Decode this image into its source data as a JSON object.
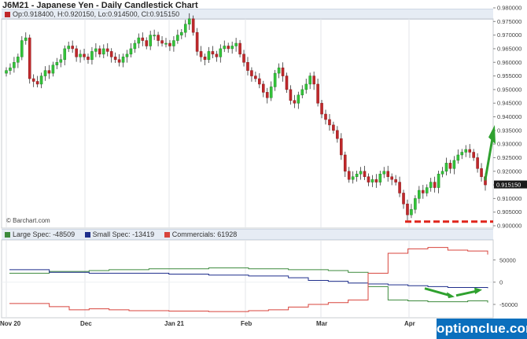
{
  "title": "J6M21 - Japanese Yen - Daily Candlestick Chart",
  "ohlc_label": "Op:0.918400, H:0.920150, Lo:0.914500, Cl:0.915150",
  "credit": "© Barchart.com",
  "watermark": "optionclue.com",
  "colors": {
    "up": "#33c43a",
    "down": "#c0282b",
    "large_spec": "#3c8a3c",
    "small_spec": "#1f2f8c",
    "commercials": "#d8443c",
    "annotation": "#e0251b",
    "arrow": "#2fa12f"
  },
  "chart_data": [
    {
      "type": "candlestick",
      "title": "J6M21 - Japanese Yen - Daily Candlestick Chart",
      "ylim": [
        0.9,
        0.98
      ],
      "y_ticks": [
        "0.980000",
        "0.975000",
        "0.970000",
        "0.965000",
        "0.960000",
        "0.955000",
        "0.950000",
        "0.945000",
        "0.940000",
        "0.935000",
        "0.930000",
        "0.925000",
        "0.920000",
        "0.915000",
        "0.910000",
        "0.905000",
        "0.900000"
      ],
      "last_price_label": "0.915150",
      "x_labels": [
        "Nov 20",
        "Dec",
        "Jan 21",
        "Feb",
        "Mar",
        "Apr"
      ],
      "closes": [
        0.957,
        0.958,
        0.96,
        0.962,
        0.968,
        0.969,
        0.954,
        0.953,
        0.952,
        0.955,
        0.957,
        0.956,
        0.959,
        0.96,
        0.961,
        0.965,
        0.966,
        0.965,
        0.962,
        0.963,
        0.962,
        0.961,
        0.964,
        0.965,
        0.963,
        0.965,
        0.964,
        0.962,
        0.961,
        0.96,
        0.962,
        0.963,
        0.965,
        0.967,
        0.969,
        0.968,
        0.966,
        0.97,
        0.97,
        0.968,
        0.967,
        0.967,
        0.966,
        0.968,
        0.97,
        0.971,
        0.974,
        0.976,
        0.971,
        0.964,
        0.962,
        0.961,
        0.964,
        0.963,
        0.962,
        0.965,
        0.966,
        0.965,
        0.966,
        0.967,
        0.963,
        0.96,
        0.957,
        0.955,
        0.954,
        0.952,
        0.949,
        0.947,
        0.951,
        0.956,
        0.958,
        0.955,
        0.95,
        0.946,
        0.945,
        0.948,
        0.95,
        0.952,
        0.955,
        0.952,
        0.945,
        0.941,
        0.939,
        0.937,
        0.935,
        0.932,
        0.926,
        0.92,
        0.917,
        0.918,
        0.919,
        0.92,
        0.918,
        0.916,
        0.917,
        0.916,
        0.919,
        0.92,
        0.918,
        0.917,
        0.916,
        0.912,
        0.908,
        0.904,
        0.906,
        0.91,
        0.913,
        0.912,
        0.914,
        0.916,
        0.914,
        0.919,
        0.92,
        0.923,
        0.921,
        0.924,
        0.926,
        0.927,
        0.928,
        0.927,
        0.925,
        0.921,
        0.918,
        0.915
      ],
      "cot_series": [
        {
          "name": "Large Spec",
          "legend_value": "-48509",
          "values": [
            20000,
            20000,
            24000,
            24000,
            26000,
            28000,
            28000,
            30000,
            30000,
            30000,
            32000,
            32000,
            30000,
            30000,
            28000,
            28000,
            26000,
            22000,
            -10000,
            -40000,
            -42000,
            -44000,
            -44000,
            -42000,
            -46000
          ]
        },
        {
          "name": "Small Spec",
          "legend_value": "-13419",
          "values": [
            28000,
            28000,
            22000,
            22000,
            20000,
            20000,
            20000,
            20000,
            18000,
            18000,
            16000,
            16000,
            14000,
            14000,
            10000,
            4000,
            2000,
            -2000,
            -4000,
            -6000,
            -8000,
            -10000,
            -12000,
            -12000,
            -13419
          ]
        },
        {
          "name": "Commercials",
          "legend_value": "61928",
          "values": [
            -48000,
            -48000,
            -55000,
            -62000,
            -60000,
            -62000,
            -64000,
            -64000,
            -65000,
            -65000,
            -66000,
            -66000,
            -64000,
            -62000,
            -56000,
            -50000,
            -46000,
            -40000,
            20000,
            65000,
            75000,
            78000,
            72000,
            70000,
            62000
          ]
        }
      ],
      "cot_ylim": [
        -80000,
        95000
      ],
      "cot_ticks": [
        "50000",
        "0",
        "-50000"
      ]
    }
  ]
}
